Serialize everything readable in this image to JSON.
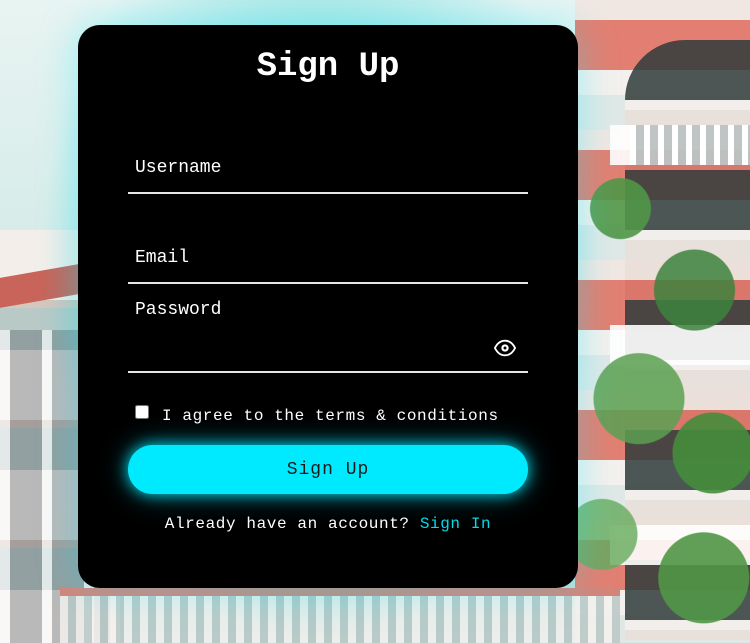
{
  "form": {
    "title": "Sign Up",
    "username": {
      "label": "Username",
      "value": ""
    },
    "email": {
      "label": "Email",
      "value": ""
    },
    "password": {
      "label": "Password",
      "value": "",
      "toggle_icon": "eye-icon"
    },
    "terms": {
      "checked": false,
      "label": "I agree to the terms & conditions"
    },
    "submit_label": "Sign Up",
    "footer": {
      "question": "Already have an account?",
      "link_label": "Sign In"
    }
  },
  "colors": {
    "card_bg": "#000000",
    "accent": "#00eaff",
    "link": "#00dcec",
    "text": "#ffffff"
  }
}
